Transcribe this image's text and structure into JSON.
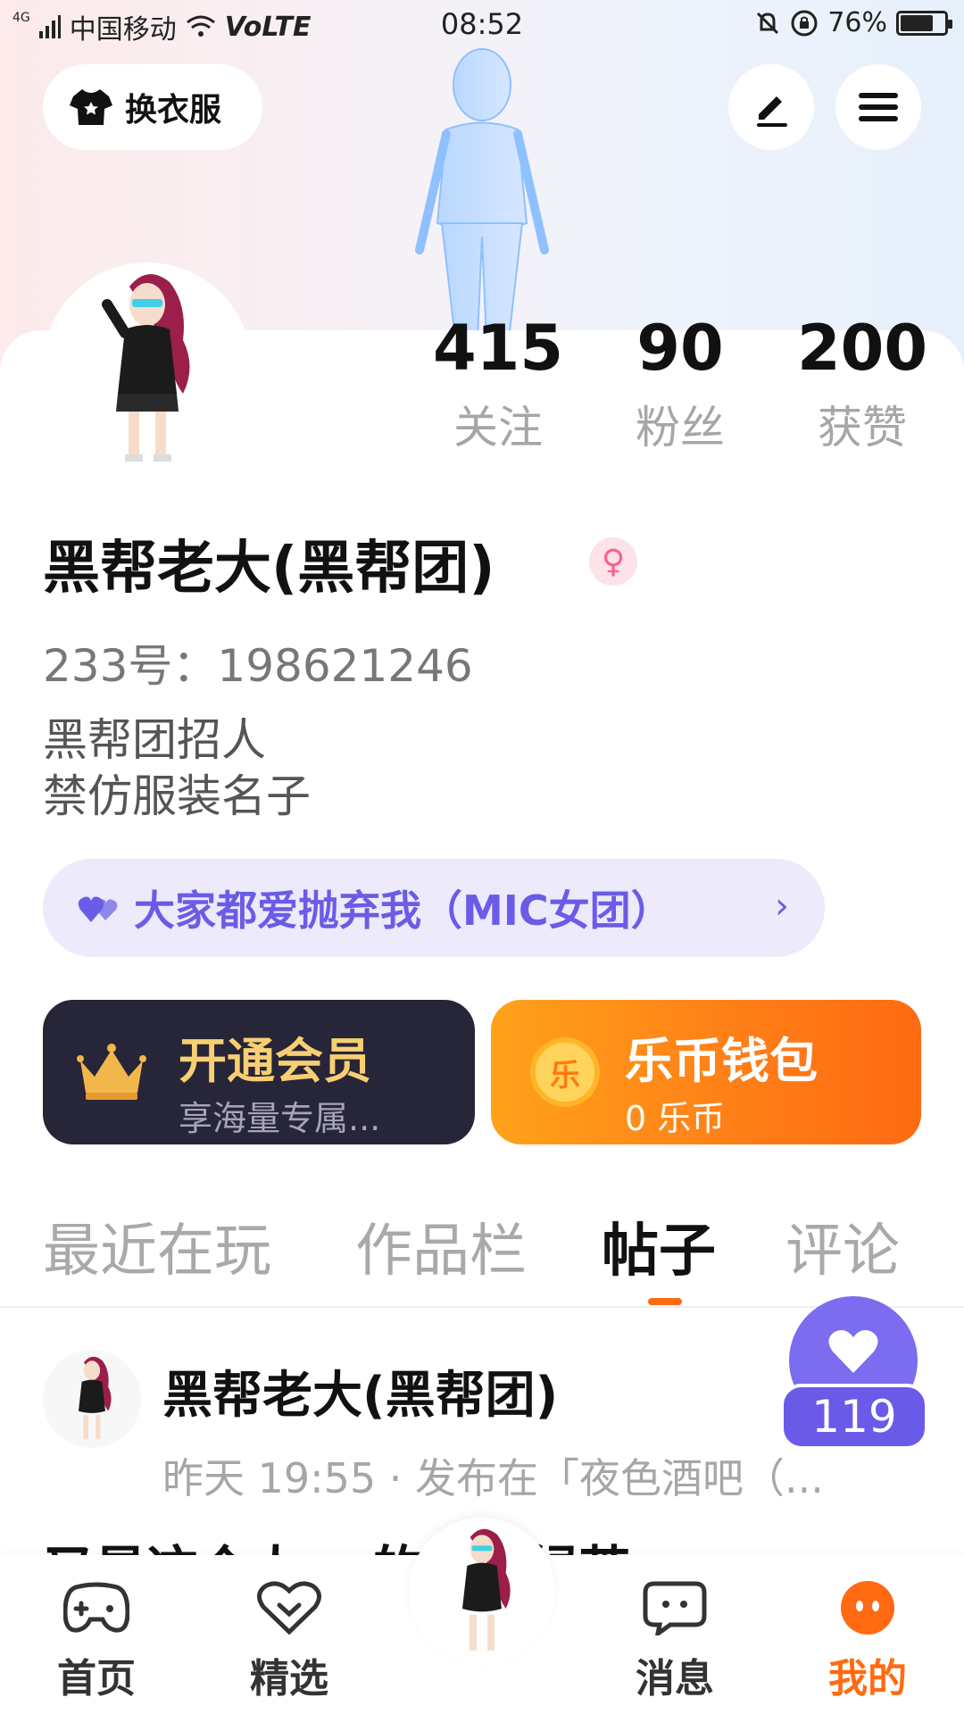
{
  "status_bar": {
    "network": "4G",
    "carrier": "中国移动",
    "volte": "VoLTE",
    "time": "08:52",
    "battery": "76%",
    "battery_level": 0.76
  },
  "header": {
    "outfit_label": "换衣服"
  },
  "profile": {
    "stats": [
      {
        "value": "415",
        "label": "关注"
      },
      {
        "value": "90",
        "label": "粉丝"
      },
      {
        "value": "200",
        "label": "获赞"
      }
    ],
    "name": "黑帮老大(黑帮团)",
    "uid": "233号：198621246",
    "bio": [
      "黑帮团招人",
      "禁仿服装名子"
    ],
    "group": "大家都爱抛弃我（MIC女团）"
  },
  "cards": {
    "vip_title": "开通会员",
    "vip_sub": "享海量专属...",
    "wallet_title": "乐币钱包",
    "wallet_sub": "0 乐币",
    "coin_glyph": "乐"
  },
  "tabs": [
    "最近在玩",
    "作品栏",
    "帖子",
    "评论"
  ],
  "active_tab": "帖子",
  "post": {
    "author": "黑帮老大(黑帮团)",
    "meta": "昨天 19:55 · 发布在「夜色酒吧（...",
    "text_partial": "又是这个人，     的叫人绿茶",
    "likes": "119"
  },
  "nav": [
    {
      "label": "首页"
    },
    {
      "label": "精选"
    },
    {
      "label": "消息"
    },
    {
      "label": "我的"
    }
  ],
  "colors": {
    "accent": "#ff6a12",
    "purple": "#6a5ce6",
    "gold": "#f7cf72"
  }
}
